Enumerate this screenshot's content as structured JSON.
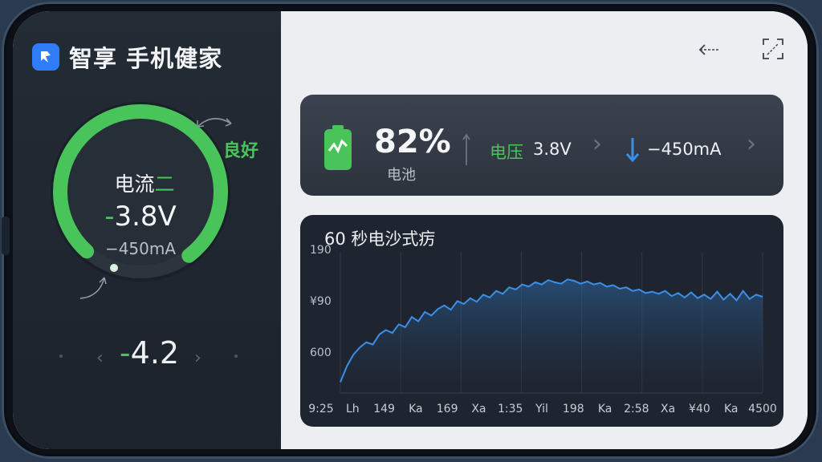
{
  "app": {
    "title": "智享 手机健家"
  },
  "gauge": {
    "label": "电流",
    "label_tail": "二",
    "voltage_sign": "-",
    "voltage": "3.8V",
    "current": "−450mA",
    "status": "良好",
    "fill_percent": 78
  },
  "bottom": {
    "sign": "-",
    "value": "4.2"
  },
  "stats": {
    "battery_percent": "82%",
    "battery_label": "电池",
    "voltage_label": "电压",
    "voltage_value": "3.8V",
    "current_value": "−450mA"
  },
  "colors": {
    "accent": "#49c45a",
    "chart_line": "#3b8fe6",
    "app_icon": "#2f7cf6"
  },
  "chart_data": {
    "type": "area",
    "title": "60 秒电沙式疠",
    "y_ticks": [
      "190",
      "¥90",
      "600"
    ],
    "x_ticks": [
      "9:25",
      "Lh",
      "149",
      "Ka",
      "169",
      "Xa",
      "1:35",
      "Yil",
      "198",
      "Ka",
      "2:58",
      "Xa",
      "¥40",
      "Ka",
      "4500"
    ],
    "y": [
      600,
      622,
      638,
      648,
      655,
      652,
      666,
      672,
      668,
      680,
      676,
      690,
      684,
      697,
      692,
      701,
      706,
      700,
      712,
      708,
      716,
      711,
      721,
      717,
      726,
      722,
      731,
      728,
      735,
      732,
      738,
      735,
      741,
      738,
      736,
      742,
      740,
      736,
      739,
      735,
      737,
      732,
      734,
      729,
      731,
      726,
      728,
      723,
      725,
      722,
      726,
      719,
      723,
      717,
      724,
      716,
      721,
      715,
      725,
      714,
      722,
      713,
      726,
      715,
      721,
      718
    ],
    "ylim": [
      585,
      780
    ]
  }
}
